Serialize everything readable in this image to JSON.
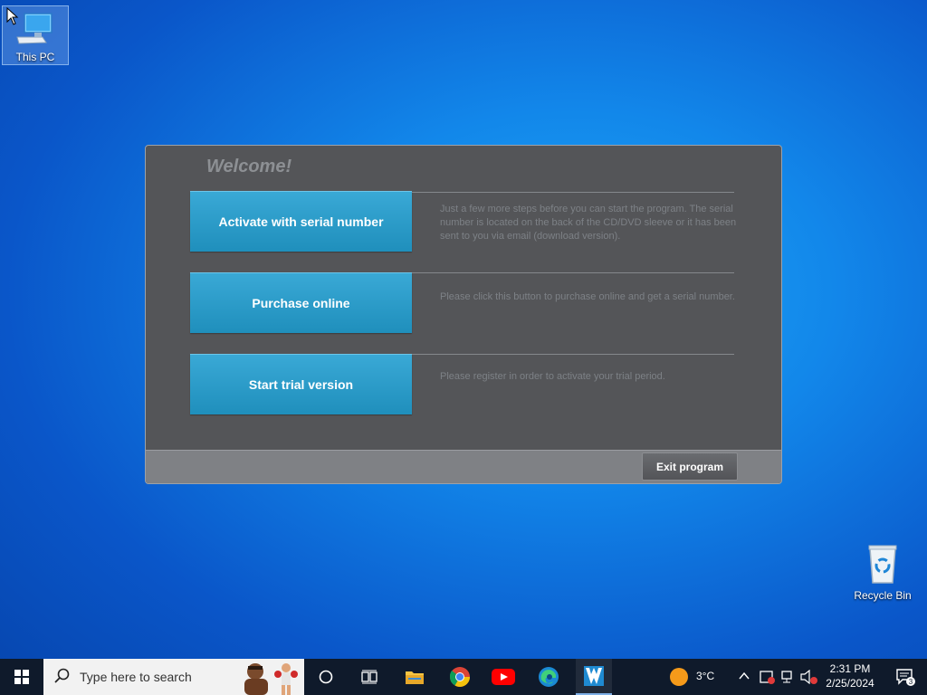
{
  "desktop": {
    "icons": [
      {
        "label": "This PC",
        "icon": "computer-icon"
      },
      {
        "label": "Recycle Bin",
        "icon": "recycle-bin-icon"
      }
    ]
  },
  "dialog": {
    "title": "Welcome!",
    "options": [
      {
        "label": "Activate with serial number",
        "description": "Just a few more steps before you can start the program. The serial number is located on the back of the CD/DVD sleeve or it has been sent to you via email (download version)."
      },
      {
        "label": "Purchase online",
        "description": "Please click this button to purchase online and get a serial number."
      },
      {
        "label": "Start trial version",
        "description": "Please register in order to activate your trial period."
      }
    ],
    "exit_label": "Exit program"
  },
  "taskbar": {
    "search_placeholder": "Type here to search",
    "apps": [
      "task-view",
      "file-explorer",
      "chrome",
      "youtube",
      "edge",
      "installer-app"
    ],
    "weather": "3°C",
    "time": "2:31 PM",
    "date": "2/25/2024",
    "notification_count": "3",
    "colors": {
      "bar": "#0f1a2b",
      "accent": "#2f9fcc"
    }
  }
}
